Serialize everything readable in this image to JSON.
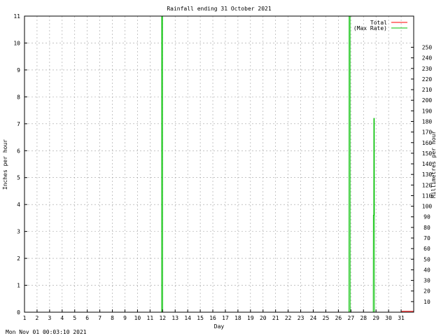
{
  "footer": {
    "timestamp": "Mon Nov 01 00:03:10 2021"
  },
  "colors": {
    "total": "#ff0000",
    "max_rate": "#00c000",
    "grid": "#a0a0a0",
    "axis": "#000000"
  },
  "chart_data": {
    "type": "line",
    "title": "Rainfall ending 31 October 2021",
    "xlabel": "Day",
    "ylabel": "Inches per hour",
    "y2label": "Millimetres per hour",
    "xlim": [
      1,
      32
    ],
    "ylim": [
      0,
      11
    ],
    "y2lim": [
      0,
      279.4
    ],
    "xticks": [
      1,
      2,
      3,
      4,
      5,
      6,
      7,
      8,
      9,
      10,
      11,
      12,
      13,
      14,
      15,
      16,
      17,
      18,
      19,
      20,
      21,
      22,
      23,
      24,
      25,
      26,
      27,
      28,
      29,
      30,
      31
    ],
    "yticks": [
      0,
      1,
      2,
      3,
      4,
      5,
      6,
      7,
      8,
      9,
      10,
      11
    ],
    "y2ticks": [
      10,
      20,
      30,
      40,
      50,
      60,
      70,
      80,
      90,
      100,
      110,
      120,
      130,
      140,
      150,
      160,
      170,
      180,
      190,
      200,
      210,
      220,
      230,
      240,
      250
    ],
    "grid": true,
    "legend_position": "top-right",
    "series": [
      {
        "name": "Total",
        "color": "#ff0000",
        "x": [
          1,
          31.0,
          31.1,
          32
        ],
        "y": [
          0,
          0,
          0.03,
          0.03
        ]
      },
      {
        "name": "(Max Rate)",
        "color": "#00c000",
        "x": [
          1,
          11.92,
          11.93,
          11.99,
          12.0,
          12.0,
          26.85,
          26.86,
          26.93,
          26.94,
          27.0,
          28.78,
          28.79,
          28.82,
          28.83,
          28.86,
          28.87,
          32
        ],
        "y": [
          0,
          0,
          11,
          11,
          0,
          0,
          0,
          11,
          11,
          0,
          0,
          0,
          3.6,
          3.6,
          7.2,
          7.2,
          0,
          0
        ]
      }
    ]
  }
}
